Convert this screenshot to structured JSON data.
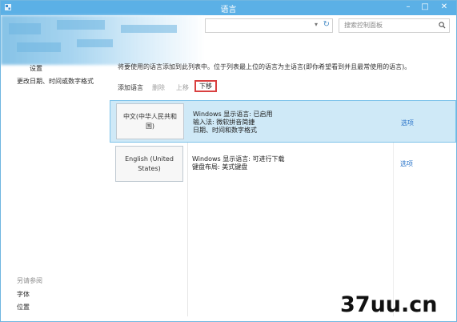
{
  "window": {
    "title": "语言",
    "controls": {
      "minimize": "–",
      "maximize": "□",
      "close": "✕"
    }
  },
  "address_bar": {
    "chevron": "▾",
    "refresh": "↻"
  },
  "search": {
    "placeholder": "搜索控制面板",
    "icon": "search-icon"
  },
  "sidebar": {
    "links": [
      "设置",
      "更改日期、时间或数字格式"
    ],
    "see_also_heading": "另请参阅",
    "see_also": [
      "字体",
      "位置"
    ]
  },
  "main": {
    "description": "将要使用的语言添加到此列表中。位于列表最上位的语言为主语言(即你希望看到并且最常使用的语言)。",
    "toolbar": {
      "add": "添加语言",
      "remove": "删除",
      "up": "上移",
      "down": "下移"
    },
    "languages": [
      {
        "name": "中文(中华人民共和国)",
        "details": [
          "Windows 显示语言: 已启用",
          "输入法: 微软拼音简捷",
          "日期、时间和数字格式"
        ],
        "options": "选项"
      },
      {
        "name": "English (United States)",
        "details": [
          "Windows 显示语言: 可进行下载",
          "键盘布局: 美式键盘"
        ],
        "options": "选项"
      }
    ]
  },
  "watermark": "37uu.cn",
  "colors": {
    "titlebar": "#5bb0e6",
    "selected_row": "#cfe9f7",
    "link": "#2a74c9",
    "highlight_border": "#d94040"
  }
}
